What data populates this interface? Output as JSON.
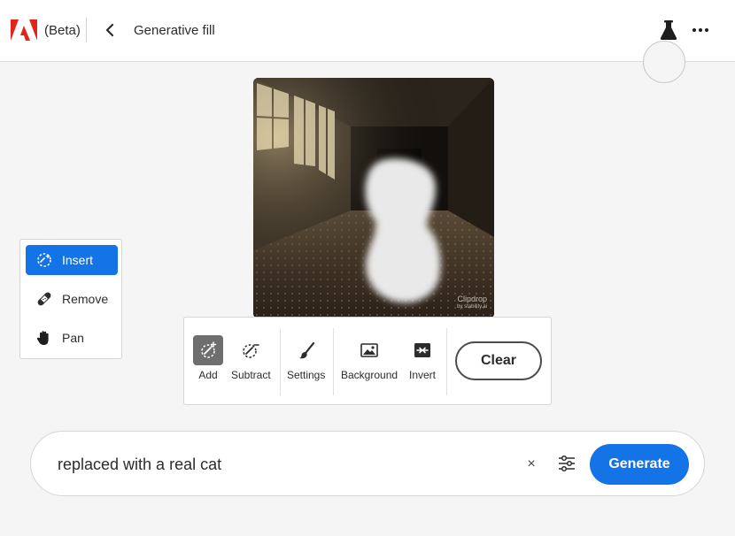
{
  "header": {
    "beta_label": "(Beta)",
    "title": "Generative fill",
    "icons": [
      "adobe-logo",
      "chevron-left-icon",
      "flask-icon",
      "more-icon"
    ]
  },
  "canvas": {
    "watermark_line1": "Clipdrop",
    "watermark_line2": "by stability.ai"
  },
  "tool_panel": {
    "items": [
      {
        "label": "Insert",
        "icon": "brush-sparkle-icon",
        "active": true
      },
      {
        "label": "Remove",
        "icon": "bandage-icon",
        "active": false
      },
      {
        "label": "Pan",
        "icon": "hand-icon",
        "active": false
      }
    ]
  },
  "toolbar": {
    "buttons": [
      {
        "label": "Add",
        "icon": "brush-add-icon",
        "selected": true
      },
      {
        "label": "Subtract",
        "icon": "brush-subtract-icon",
        "selected": false
      },
      {
        "label": "Settings",
        "icon": "brush-icon",
        "selected": false
      },
      {
        "label": "Background",
        "icon": "image-icon",
        "selected": false
      },
      {
        "label": "Invert",
        "icon": "invert-icon",
        "selected": false
      }
    ],
    "clear_label": "Clear"
  },
  "prompt": {
    "value": "replaced with a real cat",
    "clear_symbol": "×",
    "generate_label": "Generate"
  },
  "colors": {
    "accent": "#1473e6",
    "brand_red": "#e1251b",
    "selected_tool_bg": "#6e6e6e"
  }
}
